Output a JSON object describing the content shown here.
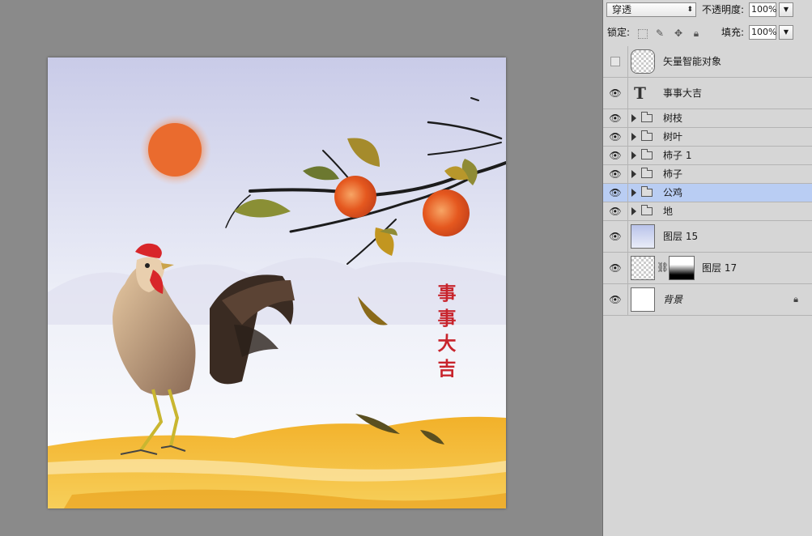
{
  "canvas": {
    "art_text": [
      "事",
      "事",
      "大",
      "吉"
    ]
  },
  "panel": {
    "blend_mode": "穿透",
    "opacity_label": "不透明度:",
    "opacity_value": "100%",
    "lock_label": "锁定:",
    "fill_label": "填充:",
    "fill_value": "100%",
    "layers": [
      {
        "name": "矢量智能对象",
        "kind": "smart-object",
        "visible": false
      },
      {
        "name": "事事大吉",
        "kind": "text",
        "visible": true
      },
      {
        "name": "树枝",
        "kind": "group",
        "visible": true
      },
      {
        "name": "树叶",
        "kind": "group",
        "visible": true
      },
      {
        "name": "柿子 1",
        "kind": "group",
        "visible": true
      },
      {
        "name": "柿子",
        "kind": "group",
        "visible": true
      },
      {
        "name": "公鸡",
        "kind": "group",
        "visible": true,
        "selected": true
      },
      {
        "name": "地",
        "kind": "group",
        "visible": true
      },
      {
        "name": "图层 15",
        "kind": "pixel",
        "visible": true
      },
      {
        "name": "图层 17",
        "kind": "pixel-mask",
        "visible": true
      },
      {
        "name": "背景",
        "kind": "background",
        "visible": true,
        "locked": true
      }
    ]
  }
}
